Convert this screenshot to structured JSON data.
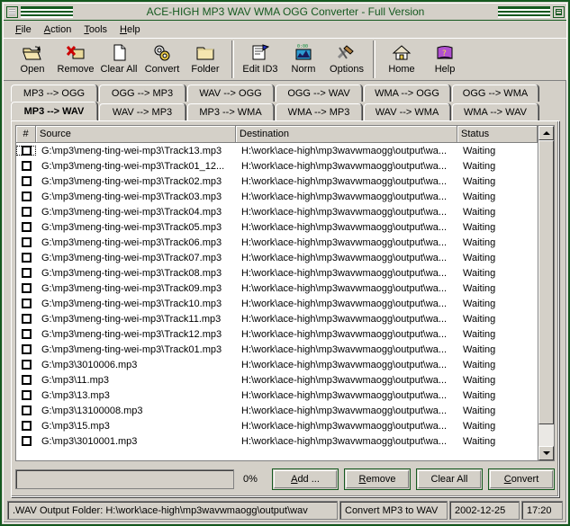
{
  "window": {
    "title": "ACE-HIGH MP3 WAV WMA OGG Converter - Full Version",
    "border_color": "#14591f",
    "face_color": "#d4d0c8"
  },
  "menu": [
    {
      "label": "File",
      "accel": "F"
    },
    {
      "label": "Action",
      "accel": "A"
    },
    {
      "label": "Tools",
      "accel": "T"
    },
    {
      "label": "Help",
      "accel": "H"
    }
  ],
  "toolbar": {
    "groups": [
      [
        {
          "label": "Open",
          "icon": "open-folder-icon"
        },
        {
          "label": "Remove",
          "icon": "remove-folder-icon"
        },
        {
          "label": "Clear All",
          "icon": "blank-page-icon"
        },
        {
          "label": "Convert",
          "icon": "gears-icon"
        },
        {
          "label": "Folder",
          "icon": "folder-icon"
        }
      ],
      [
        {
          "label": "Edit ID3",
          "icon": "edit-id3-clipboard-icon"
        },
        {
          "label": "Norm",
          "icon": "normalize-level-icon"
        },
        {
          "label": "Options",
          "icon": "hammer-wrench-icon"
        }
      ],
      [
        {
          "label": "Home",
          "icon": "house-icon"
        },
        {
          "label": "Help",
          "icon": "help-book-icon"
        }
      ]
    ]
  },
  "tabs": {
    "row1": [
      "MP3 --> OGG",
      "OGG --> MP3",
      "WAV --> OGG",
      "OGG --> WAV",
      "WMA --> OGG",
      "OGG --> WMA"
    ],
    "row2": [
      "MP3 --> WAV",
      "WAV --> MP3",
      "MP3 --> WMA",
      "WMA --> MP3",
      "WAV --> WMA",
      "WMA --> WAV"
    ],
    "active": "MP3 --> WAV"
  },
  "list": {
    "columns": [
      "#",
      "Source",
      "Destination",
      "Status"
    ],
    "rows": [
      {
        "source": "G:\\mp3\\meng-ting-wei-mp3\\Track13.mp3",
        "destination": "H:\\work\\ace-high\\mp3wavwmaogg\\output\\wa...",
        "status": "Waiting",
        "checked": false
      },
      {
        "source": "G:\\mp3\\meng-ting-wei-mp3\\Track01_12...",
        "destination": "H:\\work\\ace-high\\mp3wavwmaogg\\output\\wa...",
        "status": "Waiting",
        "checked": false
      },
      {
        "source": "G:\\mp3\\meng-ting-wei-mp3\\Track02.mp3",
        "destination": "H:\\work\\ace-high\\mp3wavwmaogg\\output\\wa...",
        "status": "Waiting",
        "checked": false
      },
      {
        "source": "G:\\mp3\\meng-ting-wei-mp3\\Track03.mp3",
        "destination": "H:\\work\\ace-high\\mp3wavwmaogg\\output\\wa...",
        "status": "Waiting",
        "checked": false
      },
      {
        "source": "G:\\mp3\\meng-ting-wei-mp3\\Track04.mp3",
        "destination": "H:\\work\\ace-high\\mp3wavwmaogg\\output\\wa...",
        "status": "Waiting",
        "checked": false
      },
      {
        "source": "G:\\mp3\\meng-ting-wei-mp3\\Track05.mp3",
        "destination": "H:\\work\\ace-high\\mp3wavwmaogg\\output\\wa...",
        "status": "Waiting",
        "checked": false
      },
      {
        "source": "G:\\mp3\\meng-ting-wei-mp3\\Track06.mp3",
        "destination": "H:\\work\\ace-high\\mp3wavwmaogg\\output\\wa...",
        "status": "Waiting",
        "checked": false
      },
      {
        "source": "G:\\mp3\\meng-ting-wei-mp3\\Track07.mp3",
        "destination": "H:\\work\\ace-high\\mp3wavwmaogg\\output\\wa...",
        "status": "Waiting",
        "checked": false
      },
      {
        "source": "G:\\mp3\\meng-ting-wei-mp3\\Track08.mp3",
        "destination": "H:\\work\\ace-high\\mp3wavwmaogg\\output\\wa...",
        "status": "Waiting",
        "checked": false
      },
      {
        "source": "G:\\mp3\\meng-ting-wei-mp3\\Track09.mp3",
        "destination": "H:\\work\\ace-high\\mp3wavwmaogg\\output\\wa...",
        "status": "Waiting",
        "checked": false
      },
      {
        "source": "G:\\mp3\\meng-ting-wei-mp3\\Track10.mp3",
        "destination": "H:\\work\\ace-high\\mp3wavwmaogg\\output\\wa...",
        "status": "Waiting",
        "checked": false
      },
      {
        "source": "G:\\mp3\\meng-ting-wei-mp3\\Track11.mp3",
        "destination": "H:\\work\\ace-high\\mp3wavwmaogg\\output\\wa...",
        "status": "Waiting",
        "checked": false
      },
      {
        "source": "G:\\mp3\\meng-ting-wei-mp3\\Track12.mp3",
        "destination": "H:\\work\\ace-high\\mp3wavwmaogg\\output\\wa...",
        "status": "Waiting",
        "checked": false
      },
      {
        "source": "G:\\mp3\\meng-ting-wei-mp3\\Track01.mp3",
        "destination": "H:\\work\\ace-high\\mp3wavwmaogg\\output\\wa...",
        "status": "Waiting",
        "checked": false
      },
      {
        "source": "G:\\mp3\\3010006.mp3",
        "destination": "H:\\work\\ace-high\\mp3wavwmaogg\\output\\wa...",
        "status": "Waiting",
        "checked": false
      },
      {
        "source": "G:\\mp3\\11.mp3",
        "destination": "H:\\work\\ace-high\\mp3wavwmaogg\\output\\wa...",
        "status": "Waiting",
        "checked": false
      },
      {
        "source": "G:\\mp3\\13.mp3",
        "destination": "H:\\work\\ace-high\\mp3wavwmaogg\\output\\wa...",
        "status": "Waiting",
        "checked": false
      },
      {
        "source": "G:\\mp3\\13100008.mp3",
        "destination": "H:\\work\\ace-high\\mp3wavwmaogg\\output\\wa...",
        "status": "Waiting",
        "checked": false
      },
      {
        "source": "G:\\mp3\\15.mp3",
        "destination": "H:\\work\\ace-high\\mp3wavwmaogg\\output\\wa...",
        "status": "Waiting",
        "checked": false
      },
      {
        "source": "G:\\mp3\\3010001.mp3",
        "destination": "H:\\work\\ace-high\\mp3wavwmaogg\\output\\wa...",
        "status": "Waiting",
        "checked": false
      }
    ]
  },
  "controls": {
    "progress_percent": "0%",
    "progress_value": 0,
    "buttons": [
      {
        "label": "Add ...",
        "accel": "A"
      },
      {
        "label": "Remove",
        "accel": "R"
      },
      {
        "label": "Clear All",
        "accel": ""
      },
      {
        "label": "Convert",
        "accel": "C"
      }
    ]
  },
  "statusbar": {
    "output_folder": ".WAV Output Folder: H:\\work\\ace-high\\mp3wavwmaogg\\output\\wav",
    "mode": "Convert MP3 to WAV",
    "date": "2002-12-25",
    "time": "17:20"
  }
}
